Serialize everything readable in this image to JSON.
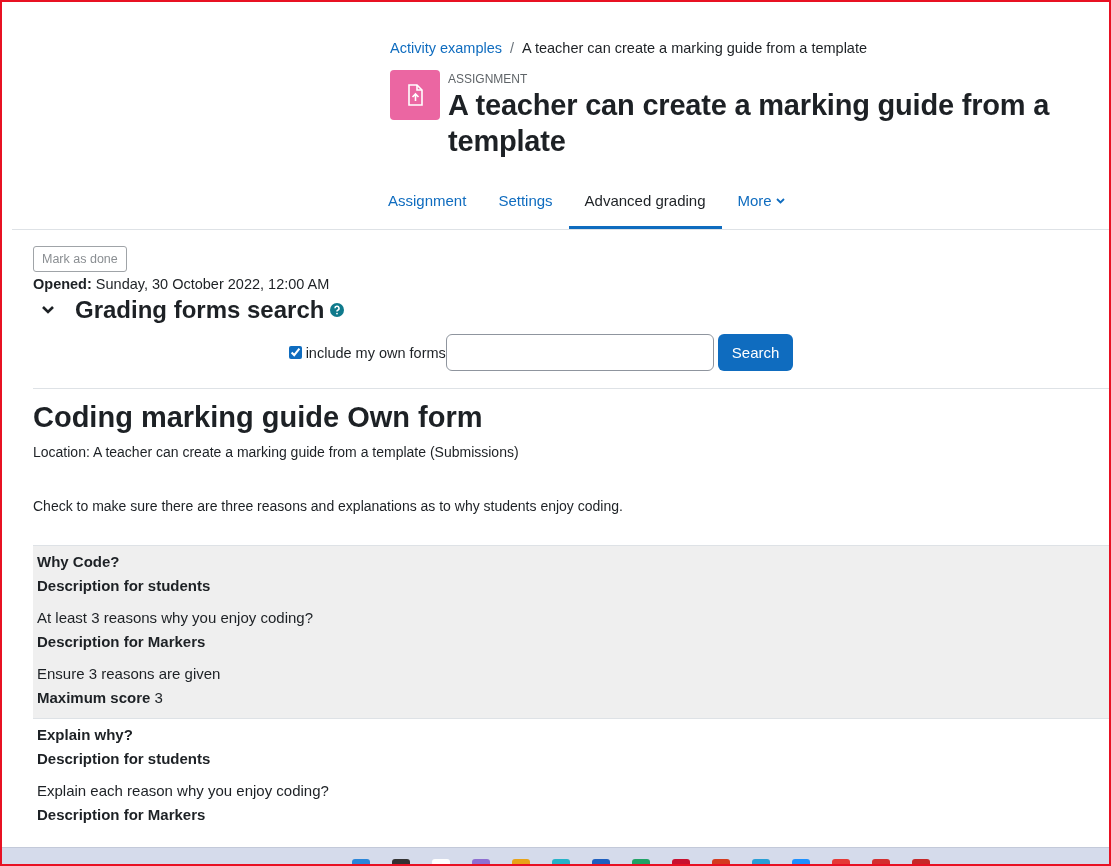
{
  "breadcrumb": [
    {
      "label": "Activity examples",
      "kind": "link"
    },
    {
      "label": "A teacher can create a marking guide from a template",
      "kind": "current"
    }
  ],
  "breadcrumb_separator": "/",
  "header": {
    "type_label": "ASSIGNMENT",
    "title": "A teacher can create a marking guide from a template"
  },
  "tabs": [
    {
      "label": "Assignment",
      "selected": false,
      "kind": "link"
    },
    {
      "label": "Settings",
      "selected": false,
      "kind": "link"
    },
    {
      "label": "Advanced grading",
      "selected": true,
      "kind": "link"
    },
    {
      "label": "More",
      "selected": false,
      "kind": "menu"
    }
  ],
  "mark_done_button": "Mark as done",
  "opened": {
    "label": "Opened:",
    "value": "Sunday, 30 October 2022, 12:00 AM"
  },
  "search_section": {
    "title": "Grading forms search",
    "expanded": true,
    "include_own_forms": {
      "label": "include my own forms",
      "checked": true
    },
    "search_button": "Search"
  },
  "form": {
    "title": "Coding marking guide Own form",
    "location": "Location: A teacher can create a marking guide from a template (Submissions)",
    "description": "Check to make sure there are three reasons and explanations as to why students enjoy coding.",
    "criteria": [
      {
        "shaded": true,
        "lines": [
          {
            "kind": "heading",
            "text": "Why Code?"
          },
          {
            "kind": "heading",
            "text": "Description for students"
          },
          {
            "kind": "text",
            "text": "At least 3 reasons why you enjoy coding?"
          },
          {
            "kind": "heading",
            "text": "Description for Markers"
          },
          {
            "kind": "text",
            "text": "Ensure 3 reasons are given"
          },
          {
            "kind": "score",
            "label": "Maximum score",
            "text": "3"
          }
        ]
      },
      {
        "shaded": false,
        "lines": [
          {
            "kind": "heading",
            "text": "Explain why?"
          },
          {
            "kind": "heading",
            "text": "Description for students"
          },
          {
            "kind": "text",
            "text": "Explain each reason why you enjoy coding?"
          },
          {
            "kind": "heading",
            "text": "Description for Markers"
          }
        ]
      }
    ]
  }
}
